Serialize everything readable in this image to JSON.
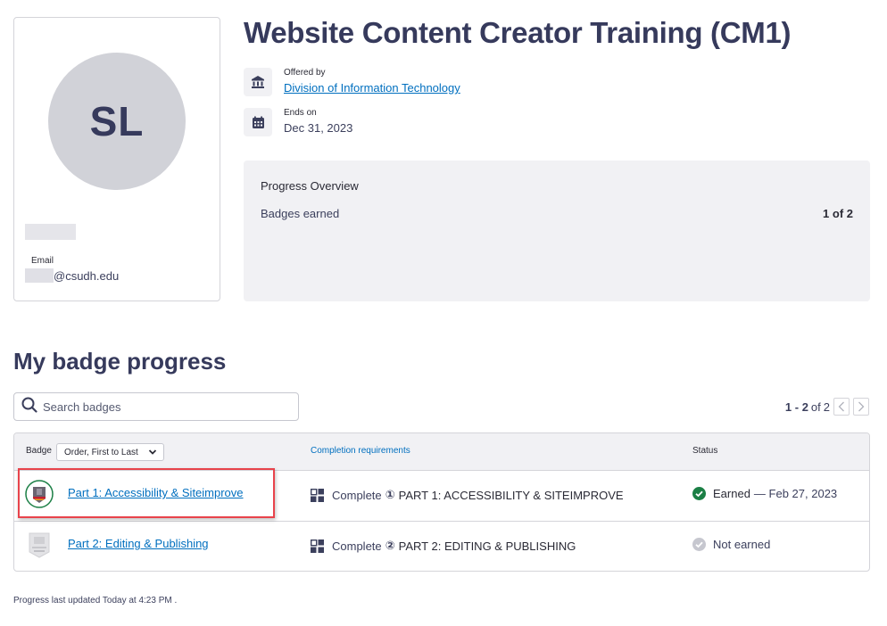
{
  "profile": {
    "initials": "SL",
    "email_label": "Email",
    "email_domain": "@csudh.edu"
  },
  "course": {
    "title": "Website Content Creator Training (CM1)",
    "offered_by_label": "Offered by",
    "offered_by_value": "Division of Information Technology",
    "ends_on_label": "Ends on",
    "ends_on_value": "Dec 31, 2023"
  },
  "overview": {
    "title": "Progress Overview",
    "badges_earned_label": "Badges earned",
    "badges_earned_value": "1 of 2"
  },
  "badges_section": {
    "title": "My badge progress",
    "search_placeholder": "Search badges",
    "pager": {
      "range": "1 - 2",
      "of_label": "of",
      "total": "2",
      "prev_icon": "chevron-left-icon",
      "next_icon": "chevron-right-icon"
    },
    "table": {
      "headers": {
        "badge": "Badge",
        "sort_selected": "Order, First to Last",
        "completion": "Completion requirements",
        "status": "Status"
      },
      "rows": [
        {
          "name": "Part 1: Accessibility & Siteimprove",
          "req_prefix": "Complete",
          "req_number": "①",
          "req_name": "PART 1: ACCESSIBILITY & SITEIMPROVE",
          "status": "Earned",
          "status_date": "— Feb 27, 2023",
          "earned": true,
          "status_color": "#1b7f45"
        },
        {
          "name": "Part 2: Editing & Publishing",
          "req_prefix": "Complete",
          "req_number": "②",
          "req_name": "PART 2: EDITING & PUBLISHING",
          "status": "Not earned",
          "status_date": "",
          "earned": false,
          "status_color": "#c6c7cf"
        }
      ]
    }
  },
  "footer": {
    "text": "Progress last updated Today at 4:23 PM ."
  },
  "colors": {
    "link": "#006fbf",
    "heading": "#363a5c",
    "highlight": "#e8434b",
    "earned": "#1b7f45"
  }
}
